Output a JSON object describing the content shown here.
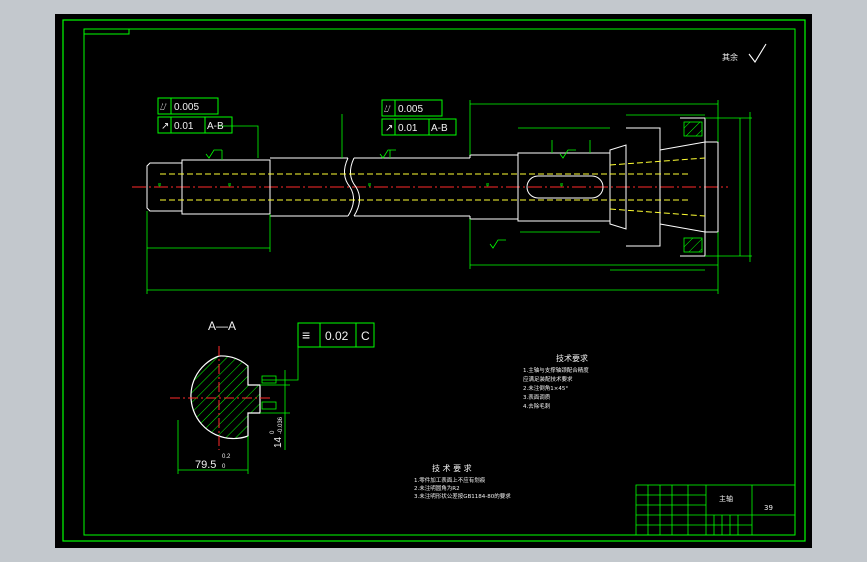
{
  "drawing": {
    "roughness_note": "其余",
    "section_label": "A—A",
    "tolerance_frames": {
      "left": {
        "runout_value": "0.005",
        "runout_value2": "0.01",
        "datum": "A-B"
      },
      "mid": {
        "runout_value": "0.005",
        "runout_value2": "0.01",
        "datum": "A-B"
      },
      "section": {
        "symbol": "≡",
        "value": "0.02",
        "datum": "C"
      }
    },
    "section_dims": {
      "width": "79.5",
      "width_tol": "0.2",
      "width_tol_low": "0",
      "key": "14",
      "key_tol": "0",
      "key_tol_low": "-0.036"
    },
    "tech_req_right": {
      "title": "技术要求",
      "items": [
        "1.主轴与支撑轴颈配合精度",
        "  应满足装配技术要求",
        "2.未注倒角1×45°",
        "3.表面调质",
        "4.去除毛刺"
      ]
    },
    "tech_req_left": {
      "title": "技 术 要 求",
      "items": [
        "1.零件加工表面上不应有划痕",
        "2.未注明圆角为R2",
        "3.未注明形状公差按GB1184-80的要求"
      ]
    },
    "title_block": {
      "part_name": "主轴",
      "drawing_code": "39"
    }
  },
  "colors": {
    "frame_bg": "#000000",
    "border": "#00ff00",
    "centerline": "#ff2a2a",
    "hidden": "#ffff33",
    "part": "#ffffff",
    "dimension": "#00ff00"
  }
}
